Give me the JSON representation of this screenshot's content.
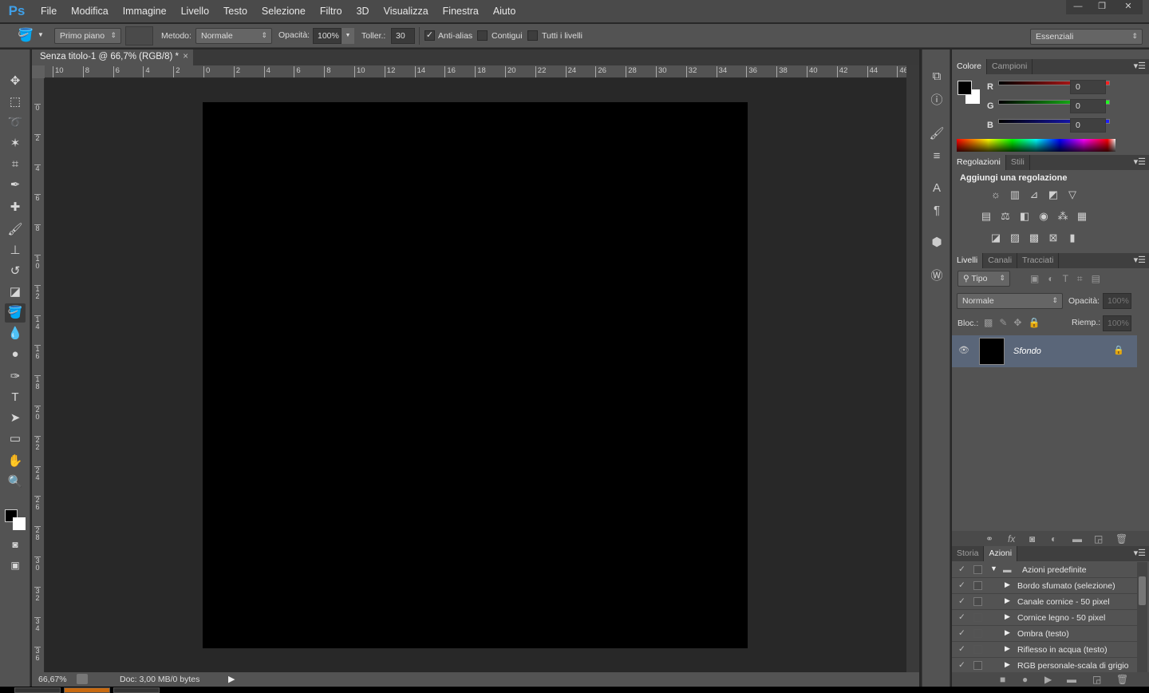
{
  "app": {
    "logo": "Ps",
    "menu": [
      "File",
      "Modifica",
      "Immagine",
      "Livello",
      "Testo",
      "Selezione",
      "Filtro",
      "3D",
      "Visualizza",
      "Finestra",
      "Aiuto"
    ],
    "window_buttons": [
      "minimize",
      "restore",
      "close"
    ]
  },
  "options": {
    "tool_icon": "paint-bucket-icon",
    "fill_source": "Primo piano",
    "method_label": "Metodo:",
    "method_value": "Normale",
    "opacity_label": "Opacità:",
    "opacity_value": "100%",
    "tolerance_label": "Toller.:",
    "tolerance_value": "30",
    "antialias_label": "Anti-alias",
    "antialias_checked": true,
    "contiguous_label": "Contigui",
    "contiguous_checked": false,
    "all_layers_label": "Tutti i livelli",
    "all_layers_checked": false,
    "workspace": "Essenziali"
  },
  "document": {
    "tab_title": "Senza titolo-1 @ 66,7% (RGB/8) *",
    "close": "×",
    "zoom": "66,67%",
    "doc_info": "Doc: 3,00 MB/0 bytes",
    "canvas_color": "#000000"
  },
  "rulers": {
    "horizontal": [
      "10",
      "8",
      "6",
      "4",
      "2",
      "0",
      "2",
      "4",
      "6",
      "8",
      "10",
      "12",
      "14",
      "16",
      "18",
      "20",
      "22",
      "24",
      "26",
      "28",
      "30",
      "32",
      "34",
      "36",
      "38",
      "40",
      "42",
      "44",
      "46"
    ],
    "vertical": [
      "0",
      "2",
      "4",
      "6",
      "8",
      "10",
      "12",
      "14",
      "16",
      "18",
      "20",
      "22",
      "24",
      "26",
      "28",
      "30",
      "32",
      "34",
      "36"
    ]
  },
  "tools": [
    "move",
    "marquee",
    "lasso",
    "magic-wand",
    "crop",
    "eyedropper",
    "spot-healing",
    "brush",
    "clone-stamp",
    "history-brush",
    "eraser",
    "paint-bucket",
    "blur",
    "dodge",
    "pen",
    "type",
    "path-selection",
    "rectangle",
    "hand",
    "zoom"
  ],
  "color_panel": {
    "tabs": [
      "Colore",
      "Campioni"
    ],
    "channels": [
      {
        "label": "R",
        "value": "0",
        "color": "#ff2020"
      },
      {
        "label": "G",
        "value": "0",
        "color": "#20ff20"
      },
      {
        "label": "B",
        "value": "0",
        "color": "#2020ff"
      }
    ],
    "foreground": "#000000",
    "background": "#ffffff"
  },
  "adjustments_panel": {
    "tabs": [
      "Regolazioni",
      "Stili"
    ],
    "heading": "Aggiungi una regolazione"
  },
  "layers_panel": {
    "tabs": [
      "Livelli",
      "Canali",
      "Tracciati"
    ],
    "filter": "Tipo",
    "blend": "Normale",
    "opacity_label": "Opacità:",
    "opacity_value": "100%",
    "lock_label": "Bloc.:",
    "fill_label": "Riemp.:",
    "fill_value": "100%",
    "layers": [
      {
        "name": "Sfondo",
        "visible": true,
        "locked": true
      }
    ]
  },
  "actions_panel": {
    "tabs": [
      "Storia",
      "Azioni"
    ],
    "set": "Azioni predefinite",
    "actions": [
      {
        "name": "Bordo sfumato (selezione)",
        "dialog": true
      },
      {
        "name": "Canale cornice - 50 pixel",
        "dialog": true
      },
      {
        "name": "Cornice legno - 50 pixel",
        "dialog": false
      },
      {
        "name": "Ombra (testo)",
        "dialog": false
      },
      {
        "name": "Riflesso in acqua (testo)",
        "dialog": false
      },
      {
        "name": "RGB personale-scala di grigio",
        "dialog": true
      }
    ]
  }
}
